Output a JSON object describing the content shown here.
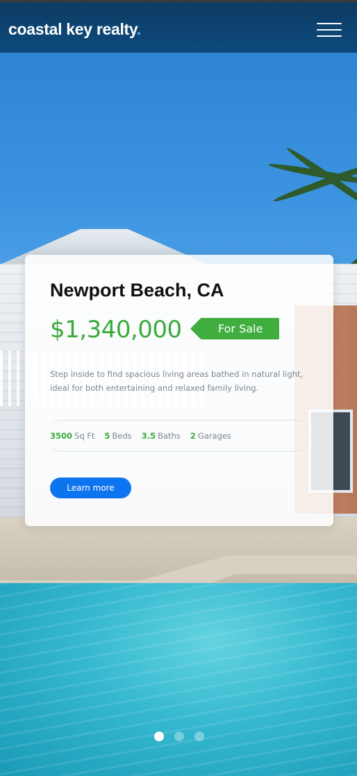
{
  "header": {
    "brand_name": "coastal key realty",
    "brand_dot": ".",
    "menu_icon": "hamburger-menu-icon"
  },
  "listing": {
    "location": "Newport Beach, CA",
    "price": "$1,340,000",
    "status_tag": "For Sale",
    "description": "Step inside to find spacious living areas bathed in natural light, ideal for both entertaining and relaxed family living.",
    "specs": [
      {
        "value": "3500",
        "unit": "Sq Ft"
      },
      {
        "value": "5",
        "unit": "Beds"
      },
      {
        "value": "3.5",
        "unit": "Baths"
      },
      {
        "value": "2",
        "unit": "Garages"
      }
    ],
    "cta_label": "Learn more"
  },
  "carousel": {
    "slide_count": 3,
    "active_index": 0
  },
  "colors": {
    "header_bg": "#0d4a7c",
    "accent_green": "#3aaa3a",
    "button_blue": "#0d74f0",
    "brand_dot": "#4fb0ff"
  }
}
